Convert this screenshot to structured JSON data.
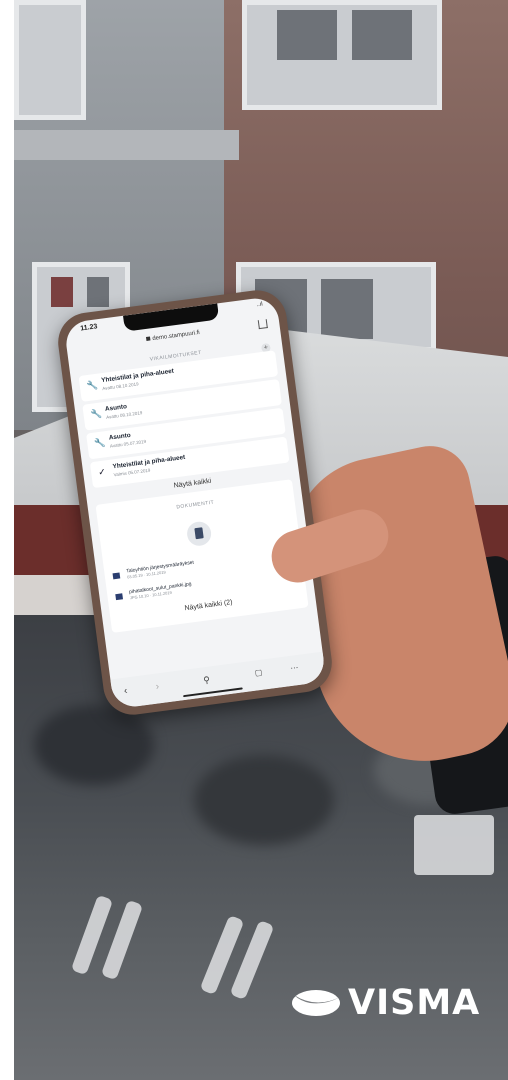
{
  "brand": {
    "logo_text": "VISMA",
    "color": "#ffffff"
  },
  "phone": {
    "status_time": "11.23",
    "status_right": "..ıl ",
    "url": "demo.stampuuri.fi",
    "section_work_orders": "VIKAILMOITUKSET",
    "work_orders": [
      {
        "title": "Yhteistilat ja piha-alueet",
        "subtitle": "Avattu 08.10.2019",
        "icon": "wrench-icon"
      },
      {
        "title": "Asunto",
        "subtitle": "Avattu 08.10.2019",
        "icon": "wrench-icon"
      },
      {
        "title": "Asunto",
        "subtitle": "Avattu 05.07.2019",
        "icon": "wrench-icon"
      },
      {
        "title": "Yhteistilat ja piha-alueet",
        "subtitle": "Valmis 05.07.2019",
        "icon": "check-icon"
      }
    ],
    "show_all_label": "Näytä kaikki",
    "section_documents": "DOKUMENTIT",
    "documents": [
      {
        "title": "Taloyhtiön järjestysmääräykset",
        "subtitle": "03.05.19 · 10.11.2019"
      },
      {
        "title": "pihatalkoot_sulut_pankki.jpg",
        "subtitle": "JPG 10.10 · 10.11.2019"
      }
    ],
    "show_all_docs_label": "Näytä kaikki (2)"
  }
}
